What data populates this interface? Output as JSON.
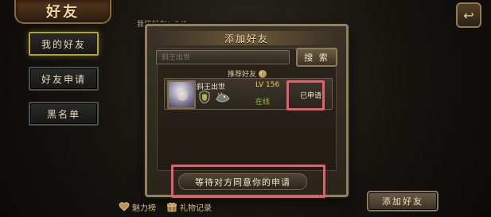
{
  "topbar": {
    "title": "好友",
    "back_icon": "back-arrow-icon"
  },
  "sidebar": {
    "items": [
      {
        "label": "我的好友",
        "active": true
      },
      {
        "label": "好友申请",
        "active": false
      },
      {
        "label": "黑名单",
        "active": false
      }
    ]
  },
  "background": {
    "list_title": "我的好友：0/0"
  },
  "bottom": {
    "tools": [
      {
        "label": "魅力榜",
        "icon": "heart-rank-icon"
      },
      {
        "label": "礼物记录",
        "icon": "gift-log-icon"
      }
    ],
    "add_friend_label": "添加好友"
  },
  "modal": {
    "title": "添加好友",
    "search": {
      "placeholder": "斜王出世",
      "button_label": "搜 索"
    },
    "recommend": {
      "label": "推荐好友",
      "icon": "info-icon"
    },
    "player": {
      "name": "斜王出世",
      "level": "LV 156",
      "status": "在线",
      "action_state": "已申请",
      "badge_icons": [
        "rank-badge-icon",
        "mount-icon"
      ]
    },
    "waiting_text": "等待对方同意你的申请"
  },
  "colors": {
    "highlight": "#e0606b",
    "online": "#8ec43d",
    "level": "#f1c44b"
  }
}
